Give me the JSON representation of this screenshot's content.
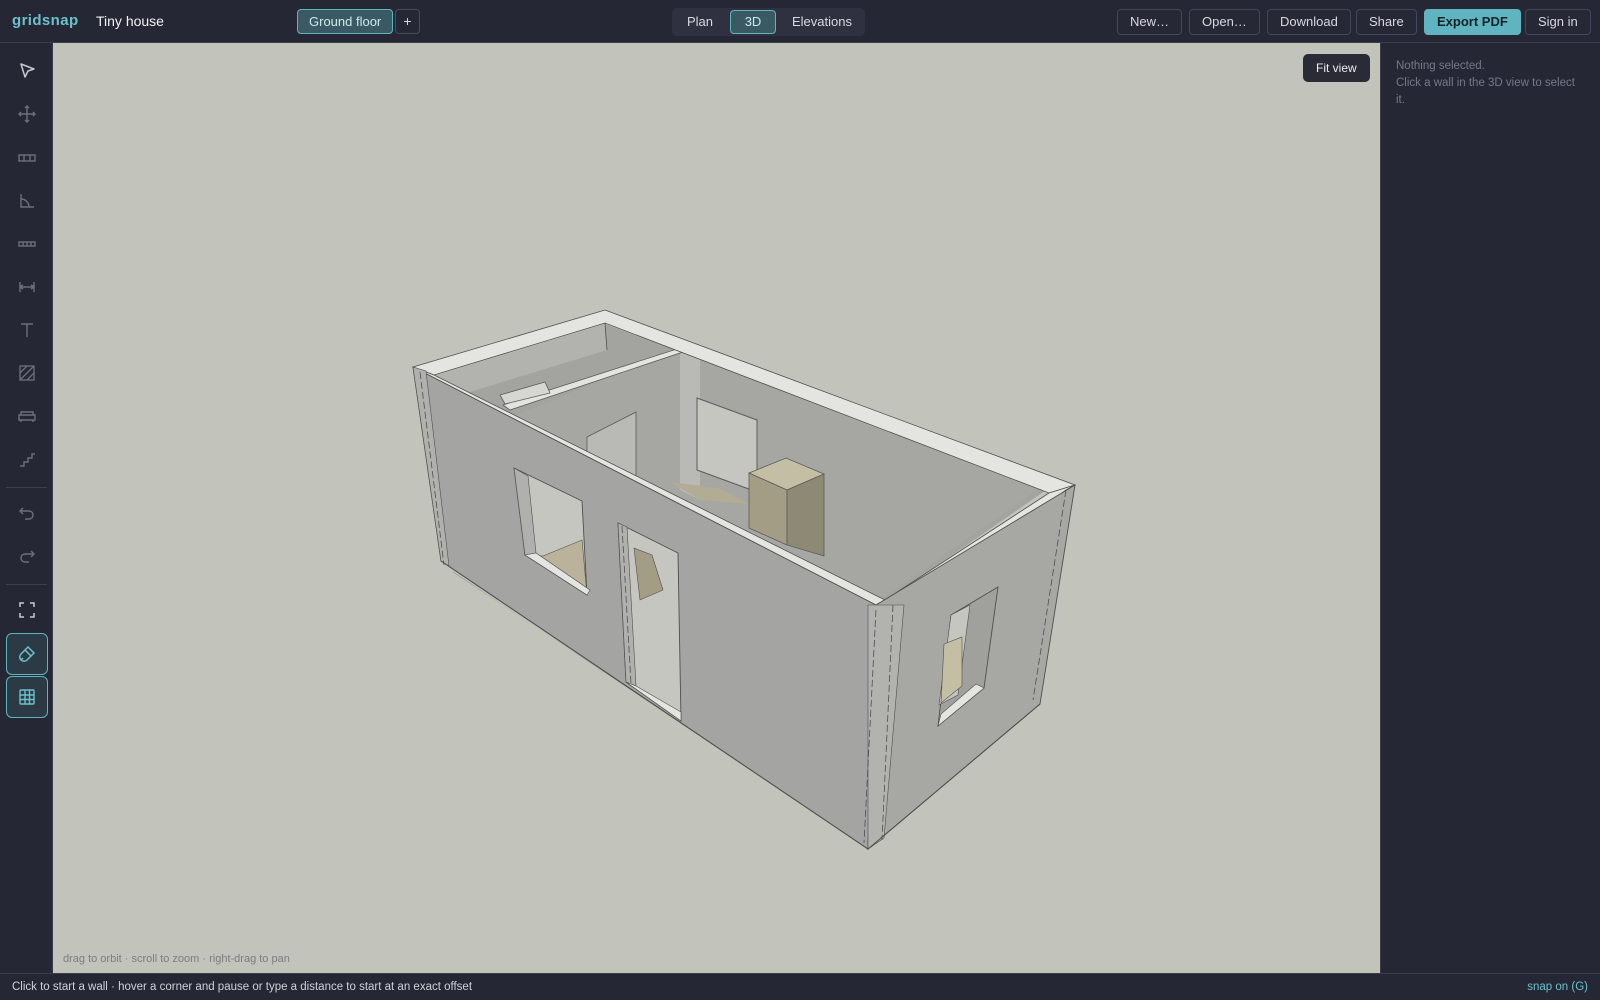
{
  "app": {
    "name": "gridsnap",
    "project_title": "Tiny house"
  },
  "floor": {
    "current": "Ground floor",
    "add_label": "+"
  },
  "views": {
    "plan": "Plan",
    "threeD": "3D",
    "elevations": "Elevations",
    "active": "3D"
  },
  "actions": {
    "new": "New…",
    "open": "Open…",
    "download": "Download",
    "share": "Share",
    "export_pdf": "Export PDF",
    "sign_in": "Sign in"
  },
  "tools": [
    {
      "name": "select",
      "icon": "cursor-icon"
    },
    {
      "name": "move",
      "icon": "move-icon"
    },
    {
      "name": "wall",
      "icon": "wall-icon"
    },
    {
      "name": "angle",
      "icon": "angle-icon"
    },
    {
      "name": "opening",
      "icon": "opening-icon"
    },
    {
      "name": "dimension",
      "icon": "dimension-icon"
    },
    {
      "name": "text",
      "icon": "text-icon"
    },
    {
      "name": "hatch",
      "icon": "hatch-icon"
    },
    {
      "name": "furniture",
      "icon": "sofa-icon"
    },
    {
      "name": "stairs",
      "icon": "stairs-icon"
    },
    {
      "name": "undo",
      "icon": "undo-icon"
    },
    {
      "name": "redo",
      "icon": "redo-icon"
    },
    {
      "name": "fit",
      "icon": "fullscreen-icon"
    },
    {
      "name": "snap",
      "icon": "magnet-icon",
      "active": true
    },
    {
      "name": "grid",
      "icon": "grid-icon",
      "active": true
    }
  ],
  "viewport": {
    "fit_view": "Fit view",
    "hint": "drag to orbit · scroll to zoom · right-drag to pan"
  },
  "panel": {
    "empty_title": "Nothing selected.",
    "empty_help": "Click a wall in the 3D view to select it."
  },
  "status": {
    "message": "Click to start a wall · hover a corner and pause or type a distance to start at an exact offset",
    "snap": "snap on (G)"
  },
  "colors": {
    "accent": "#5fb4bf",
    "chrome": "#252734",
    "viewport_bg": "#c2c3bb",
    "wall_face": "#a4a4a2",
    "wall_top": "#e4e4e0"
  }
}
